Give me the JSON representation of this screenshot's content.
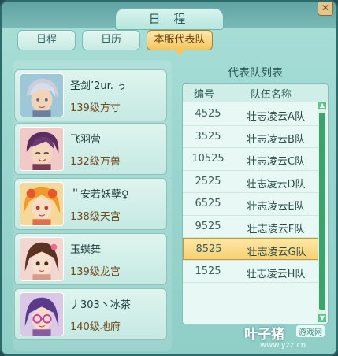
{
  "window": {
    "title": "日 程",
    "close_label": "✕"
  },
  "tabs": [
    {
      "label": "日程",
      "active": false
    },
    {
      "label": "日历",
      "active": false
    },
    {
      "label": "本服代表队",
      "active": true
    }
  ],
  "players": [
    {
      "name": "圣剑’2ur. ぅ",
      "level": "139级方寸",
      "avatar": "silver-hair-male"
    },
    {
      "name": "飞羽营",
      "level": "132级万兽",
      "avatar": "purple-hair-male"
    },
    {
      "name": "＂安若妖孽♀",
      "level": "138级天宫",
      "avatar": "orange-hair-female"
    },
    {
      "name": "玉蝶舞",
      "level": "139级龙宫",
      "avatar": "brown-hair-female"
    },
    {
      "name": "丿303丶冰茶",
      "level": "140级地府",
      "avatar": "purple-glasses-female"
    }
  ],
  "team_list": {
    "title": "代表队列表",
    "col_code": "编号",
    "col_team": "队伍名称",
    "rows": [
      {
        "code": "4525",
        "team": "壮志凌云A队",
        "selected": false
      },
      {
        "code": "3525",
        "team": "壮志凌云B队",
        "selected": false
      },
      {
        "code": "10525",
        "team": "壮志凌云C队",
        "selected": false
      },
      {
        "code": "2525",
        "team": "壮志凌云D队",
        "selected": false
      },
      {
        "code": "6525",
        "team": "壮志凌云E队",
        "selected": false
      },
      {
        "code": "9525",
        "team": "壮志凌云F队",
        "selected": false
      },
      {
        "code": "8525",
        "team": "壮志凌云G队",
        "selected": true
      },
      {
        "code": "1525",
        "team": "壮志凌云H队",
        "selected": false
      }
    ]
  },
  "watermark": {
    "brand": "叶子猪",
    "tag": "游戏网",
    "url": "www.yzz.cn"
  }
}
